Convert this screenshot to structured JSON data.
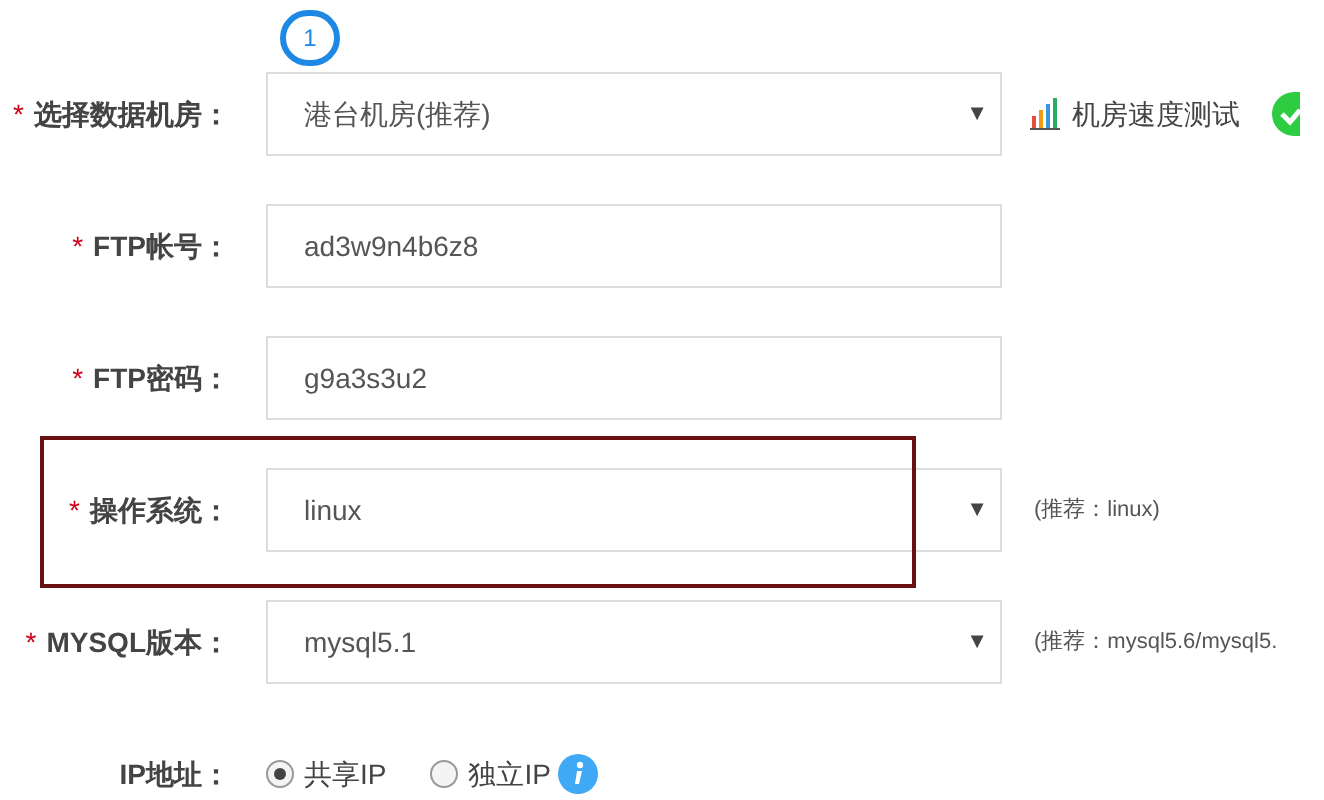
{
  "step_marker": "1",
  "rows": [
    {
      "kind": "select",
      "marker": "*",
      "label": "选择数据机房：",
      "value": "港台机房(推荐)",
      "arrow": "▼",
      "speed_test": "机房速度测试",
      "verified": true,
      "highlighted": false
    },
    {
      "kind": "text",
      "marker": "*",
      "label": "FTP帐号：",
      "value": "ad3w9n4b6z8",
      "highlighted": false
    },
    {
      "kind": "text",
      "marker": "*",
      "label": "FTP密码：",
      "value": "g9a3s3u2",
      "highlighted": false
    },
    {
      "kind": "select",
      "marker": "*",
      "label": "操作系统：",
      "value": "linux",
      "arrow": "▼",
      "hint": "(推荐：linux)",
      "highlighted": true
    },
    {
      "kind": "select",
      "marker": "*",
      "label": "MYSQL版本：",
      "value": "mysql5.1",
      "arrow": "▼",
      "hint": "(推荐：mysql5.6/mysql5.",
      "highlighted": false
    },
    {
      "kind": "radio",
      "label": "IP地址：",
      "options": [
        {
          "label": "共享IP",
          "selected": true
        },
        {
          "label": "独立IP",
          "selected": false
        }
      ]
    }
  ]
}
